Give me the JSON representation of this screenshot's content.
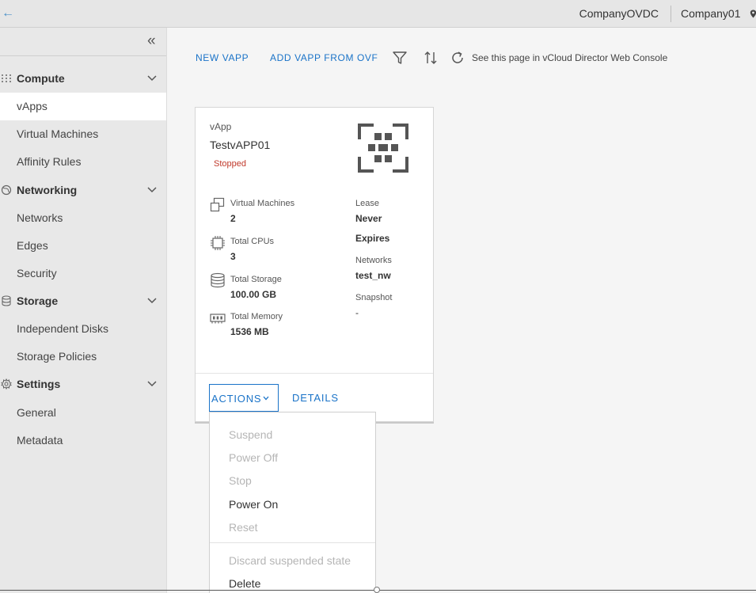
{
  "header": {
    "vdc_name": "CompanyOVDC",
    "org_name": "Company01"
  },
  "sidebar": {
    "groups": [
      {
        "label": "Compute",
        "icon": "grid-dots-icon",
        "items": [
          "vApps",
          "Virtual Machines",
          "Affinity Rules"
        ]
      },
      {
        "label": "Networking",
        "icon": "network-globe-icon",
        "items": [
          "Networks",
          "Edges",
          "Security"
        ]
      },
      {
        "label": "Storage",
        "icon": "database-icon",
        "items": [
          "Independent Disks",
          "Storage Policies"
        ]
      },
      {
        "label": "Settings",
        "icon": "gear-icon",
        "items": [
          "General",
          "Metadata"
        ]
      }
    ],
    "active_item": "vApps"
  },
  "toolbar": {
    "new_vapp": "NEW VAPP",
    "add_from_ovf": "ADD VAPP FROM OVF",
    "console_link": "See this page in vCloud Director Web Console"
  },
  "card": {
    "type_label": "vApp",
    "name": "TestvAPP01",
    "status": "Stopped",
    "stats": [
      {
        "label": "Virtual Machines",
        "value": "2",
        "icon": "vm-icon"
      },
      {
        "label": "Total CPUs",
        "value": "3",
        "icon": "cpu-icon"
      },
      {
        "label": "Total Storage",
        "value": "100.00 GB",
        "icon": "database-icon"
      },
      {
        "label": "Total Memory",
        "value": "1536 MB",
        "icon": "memory-icon"
      }
    ],
    "lease_label": "Lease",
    "lease_value_line1": "Never",
    "lease_value_line2": "Expires",
    "networks_label": "Networks",
    "networks_value": "test_nw",
    "snapshot_label": "Snapshot",
    "snapshot_value": "-",
    "actions_label": "ACTIONS",
    "details_label": "DETAILS"
  },
  "actions_menu": {
    "items": [
      {
        "label": "Suspend",
        "enabled": false
      },
      {
        "label": "Power Off",
        "enabled": false
      },
      {
        "label": "Stop",
        "enabled": false
      },
      {
        "label": "Power On",
        "enabled": true
      },
      {
        "label": "Reset",
        "enabled": false
      },
      {
        "label": "Discard suspended state",
        "enabled": false
      },
      {
        "label": "Delete",
        "enabled": true
      }
    ]
  },
  "colors": {
    "accent": "#1a73c8",
    "stopped": "#c0392b",
    "disabled_text": "#b5b5b5"
  }
}
